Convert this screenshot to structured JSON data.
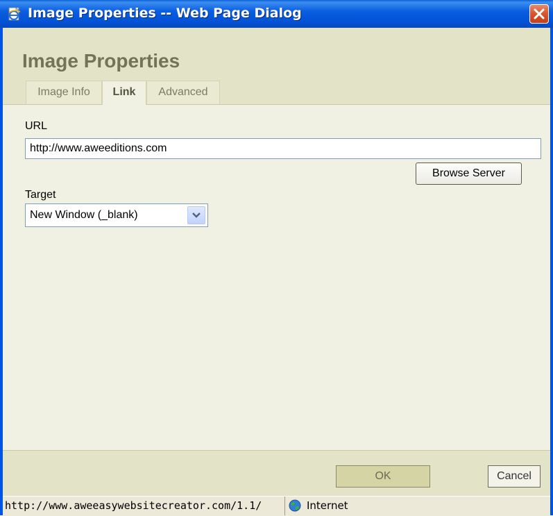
{
  "window": {
    "title": "Image Properties -- Web Page Dialog"
  },
  "dialog": {
    "title": "Image Properties"
  },
  "tabs": [
    {
      "label": "Image Info",
      "active": false
    },
    {
      "label": "Link",
      "active": true
    },
    {
      "label": "Advanced",
      "active": false
    }
  ],
  "link": {
    "url_label": "URL",
    "url_value": "http://www.aweeditions.com",
    "browse_label": "Browse Server",
    "target_label": "Target",
    "target_value": "New Window (_blank)"
  },
  "buttons": {
    "ok": "OK",
    "cancel": "Cancel"
  },
  "status": {
    "url": "http://www.aweeasywebsitecreator.com/1.1/",
    "zone": "Internet"
  },
  "colors": {
    "titlebar": "#0054e3",
    "dialog_bg": "#f1f1e3",
    "header_bg": "#e3e3c7",
    "heading_text": "#737357",
    "close_button": "#d8542e"
  },
  "icons": {
    "window": "ie-page-icon",
    "close": "close-icon",
    "dropdown": "chevron-down-icon",
    "zone": "globe-icon"
  }
}
